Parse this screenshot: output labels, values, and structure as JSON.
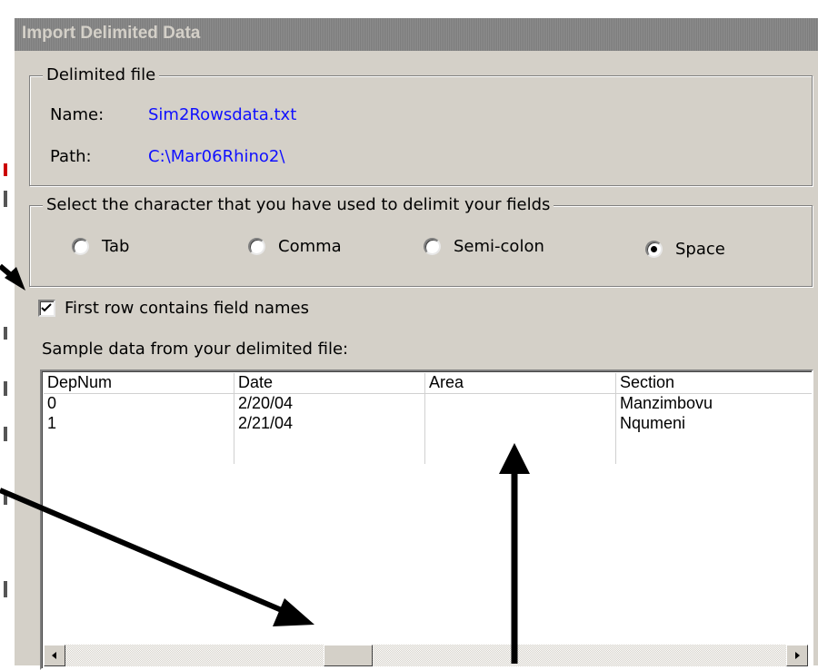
{
  "window": {
    "title": "Import Delimited Data"
  },
  "file_group": {
    "legend": "Delimited file",
    "name_label": "Name:",
    "name_value": "Sim2Rowsdata.txt",
    "path_label": "Path:",
    "path_value": "C:\\Mar06Rhino2\\"
  },
  "delimiter_group": {
    "legend": "Select the character that you have used to delimit your fields",
    "options": [
      {
        "label": "Tab",
        "selected": false
      },
      {
        "label": "Comma",
        "selected": false
      },
      {
        "label": "Semi-colon",
        "selected": false
      },
      {
        "label": "Space",
        "selected": true
      }
    ]
  },
  "first_row_checkbox": {
    "label": "First row contains field names",
    "checked": true
  },
  "sample": {
    "label": "Sample data from your delimited file:",
    "columns": [
      "DepNum",
      "Date",
      "Area",
      "Section"
    ],
    "rows": [
      [
        "0",
        "2/20/04",
        "",
        "Manzimbovu"
      ],
      [
        "1",
        "2/21/04",
        "",
        "Nqumeni"
      ]
    ]
  },
  "scrollbar": {
    "left_icon": "arrow-left-icon",
    "right_icon": "arrow-right-icon"
  }
}
